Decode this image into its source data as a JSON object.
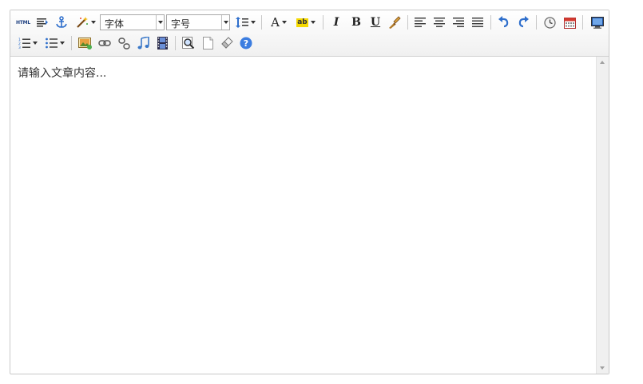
{
  "toolbar": {
    "html_label": "HTML",
    "font_family": {
      "value": "字体"
    },
    "font_size": {
      "value": "字号"
    },
    "font_color_label": "A",
    "highlight_label": "ab",
    "italic_label": "I",
    "bold_label": "B",
    "underline_label": "U",
    "icons": [
      "html-source-icon",
      "paragraph-format-icon",
      "anchor-icon",
      "magic-wand-icon",
      "line-height-icon",
      "font-color-icon",
      "highlight-color-icon",
      "italic-icon",
      "bold-icon",
      "underline-icon",
      "format-painter-icon",
      "align-left-icon",
      "align-center-icon",
      "align-right-icon",
      "align-justify-icon",
      "undo-icon",
      "redo-icon",
      "time-icon",
      "date-icon",
      "preview-icon",
      "ordered-list-icon",
      "unordered-list-icon",
      "image-icon",
      "link-icon",
      "unlink-icon",
      "music-icon",
      "video-icon",
      "find-icon",
      "new-document-icon",
      "eraser-icon",
      "help-icon"
    ]
  },
  "editor": {
    "placeholder": "请输入文章内容..."
  },
  "colors": {
    "accent_blue": "#2f6fcc",
    "help_blue": "#3b7de0",
    "toolbar_border": "#d0d0d0"
  }
}
